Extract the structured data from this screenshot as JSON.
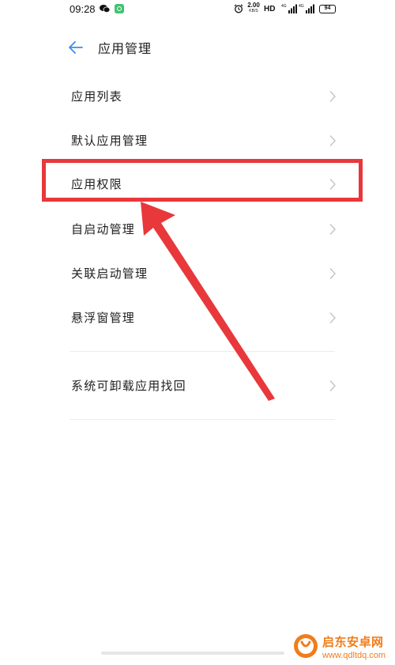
{
  "status_bar": {
    "time": "09:28",
    "net_speed_value": "2.00",
    "net_speed_unit": "KB/S",
    "hd_label": "HD",
    "signal1_label": "4G",
    "signal2_label": "4G",
    "battery_level": "94"
  },
  "header": {
    "title": "应用管理"
  },
  "menu": {
    "items": [
      {
        "label": "应用列表"
      },
      {
        "label": "默认应用管理"
      },
      {
        "label": "应用权限"
      },
      {
        "label": "自启动管理"
      },
      {
        "label": "关联启动管理"
      },
      {
        "label": "悬浮窗管理"
      },
      {
        "label": "系统可卸载应用找回"
      }
    ]
  },
  "annotation": {
    "color": "#e8383b"
  },
  "watermark": {
    "title": "启东安卓网",
    "url": "www.qdltdq.com"
  },
  "colors": {
    "accent": "#3a8ee6",
    "annotation": "#e8383b",
    "watermark": "#f07d1a"
  }
}
